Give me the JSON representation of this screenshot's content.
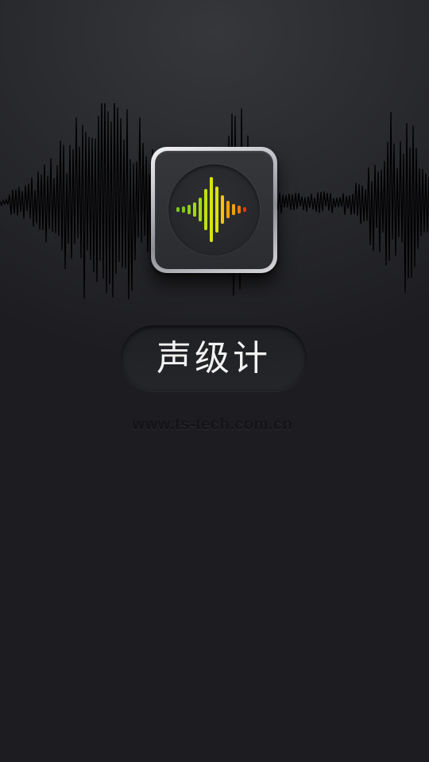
{
  "splash": {
    "app_name": "声级计",
    "website": "www.ts-tech.com.cn"
  },
  "app_icon": {
    "icon_name": "sound-level-meter-icon",
    "bar_colors": [
      "#7ec81a",
      "#8fd018",
      "#a6d814",
      "#c0e010",
      "#d8e40c",
      "#f0c808",
      "#f5a004",
      "#f07804",
      "#e83a08"
    ]
  },
  "background_waveform": {
    "icon_name": "audio-waveform",
    "color": "#000000"
  },
  "colors": {
    "background_top": "#36373b",
    "background_bottom": "#1d1d21",
    "title_text": "#f2f2f2"
  }
}
